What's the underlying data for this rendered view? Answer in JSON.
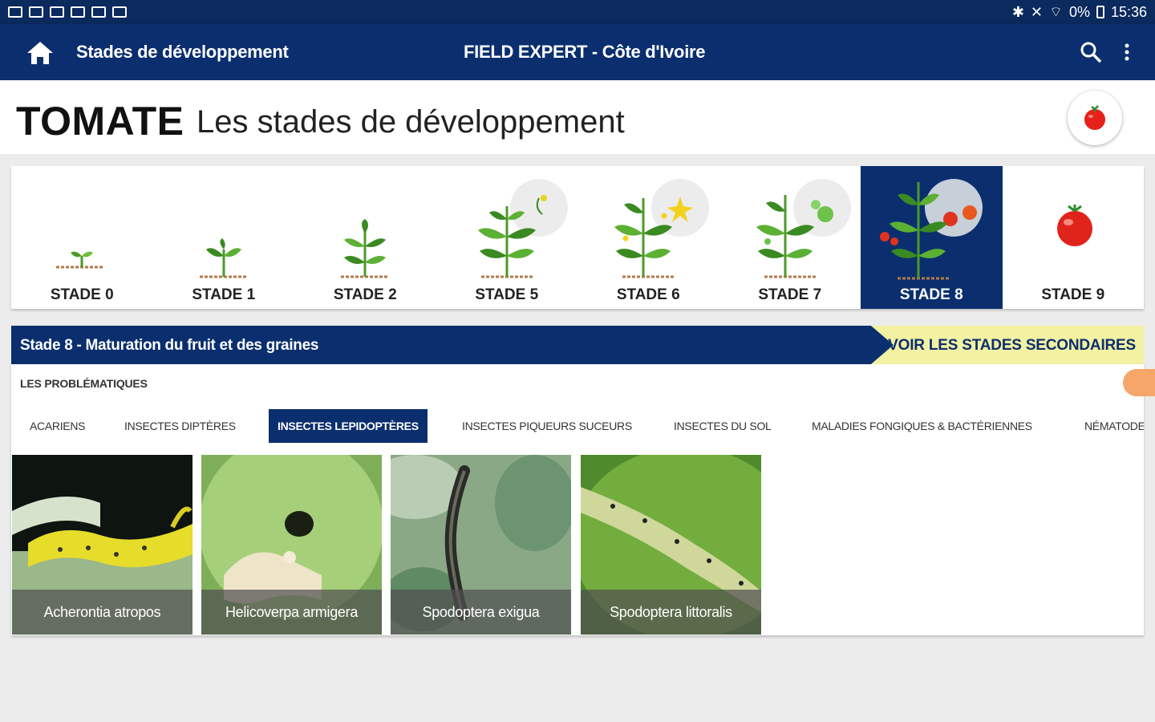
{
  "statusbar": {
    "battery": "0%",
    "time": "15:36"
  },
  "appbar": {
    "title": "Stades de développement",
    "center_title": "FIELD EXPERT - Côte d'Ivoire",
    "icons": [
      "home-icon",
      "search-icon",
      "more-vert-icon"
    ]
  },
  "header": {
    "crop": "TOMATE",
    "subtitle": "Les stades de développement",
    "badge_icon": "tomato-icon"
  },
  "stages": [
    {
      "label": "STADE 0",
      "active": false
    },
    {
      "label": "STADE 1",
      "active": false
    },
    {
      "label": "STADE 2",
      "active": false
    },
    {
      "label": "STADE 5",
      "active": false
    },
    {
      "label": "STADE 6",
      "active": false
    },
    {
      "label": "STADE 7",
      "active": false
    },
    {
      "label": "STADE 8",
      "active": true
    },
    {
      "label": "STADE 9",
      "active": false
    }
  ],
  "banner": {
    "title": "Stade 8 - Maturation du fruit et des graines",
    "secondary_button": "VOIR LES STADES SECONDAIRES"
  },
  "problems": {
    "heading": "LES PROBLÉMATIQUES",
    "tabs": [
      {
        "label": "ACARIENS",
        "active": false
      },
      {
        "label": "INSECTES DIPTÈRES",
        "active": false
      },
      {
        "label": "INSECTES LEPIDOPTÈRES",
        "active": true
      },
      {
        "label": "INSECTES PIQUEURS SUCEURS",
        "active": false
      },
      {
        "label": "INSECTES DU SOL",
        "active": false
      },
      {
        "label": "MALADIES FONGIQUES & BACTÉRIENNES",
        "active": false
      },
      {
        "label": "NÉMATODE",
        "active": false
      }
    ],
    "cards": [
      {
        "name": "Acherontia atropos"
      },
      {
        "name": "Helicoverpa armigera"
      },
      {
        "name": "Spodoptera exigua"
      },
      {
        "name": "Spodoptera littoralis"
      }
    ]
  },
  "colors": {
    "primary": "#0b2f6e",
    "accent_yellow": "#f3f1a2",
    "float_button": "#f7a66a"
  }
}
